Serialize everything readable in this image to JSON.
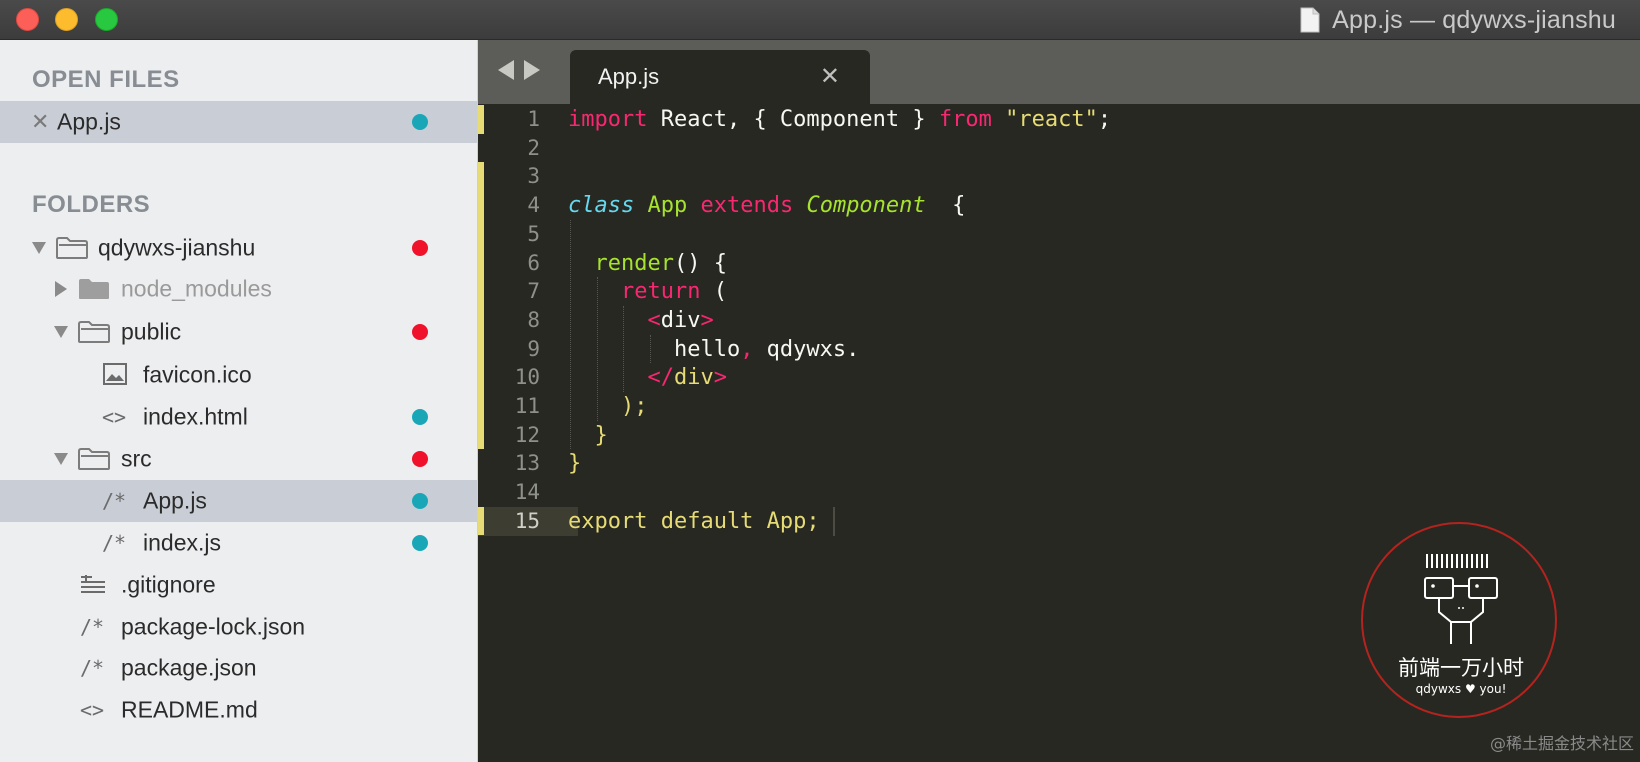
{
  "window": {
    "title": "App.js — qdywxs-jianshu"
  },
  "sidebar": {
    "open_files_header": "OPEN FILES",
    "open_files": [
      {
        "label": "App.js",
        "modified": true
      }
    ],
    "folders_header": "FOLDERS",
    "tree": [
      {
        "label": "qdywxs-jianshu",
        "type": "folder",
        "expanded": true,
        "status": "red"
      },
      {
        "label": "node_modules",
        "type": "folder",
        "expanded": false,
        "dimmed": true
      },
      {
        "label": "public",
        "type": "folder",
        "expanded": true,
        "status": "red"
      },
      {
        "label": "favicon.ico",
        "type": "image"
      },
      {
        "label": "index.html",
        "type": "markup",
        "status": "teal"
      },
      {
        "label": "src",
        "type": "folder",
        "expanded": true,
        "status": "red"
      },
      {
        "label": "App.js",
        "type": "script",
        "status": "teal",
        "selected": true
      },
      {
        "label": "index.js",
        "type": "script",
        "status": "teal"
      },
      {
        "label": ".gitignore",
        "type": "text"
      },
      {
        "label": "package-lock.json",
        "type": "script"
      },
      {
        "label": "package.json",
        "type": "script"
      },
      {
        "label": "README.md",
        "type": "markup"
      }
    ]
  },
  "editor": {
    "tab_label": "App.js",
    "current_line": 15,
    "lines": [
      {
        "n": "1",
        "tokens": [
          [
            "kw",
            "import"
          ],
          [
            "pl",
            " React, { Component } "
          ],
          [
            "kw",
            "from"
          ],
          [
            "pl",
            " "
          ],
          [
            "str",
            "\"react\""
          ],
          [
            "pl",
            ";"
          ]
        ]
      },
      {
        "n": "2",
        "tokens": []
      },
      {
        "n": "3",
        "tokens": []
      },
      {
        "n": "4",
        "tokens": [
          [
            "cls",
            "class"
          ],
          [
            "pl",
            " "
          ],
          [
            "nm",
            "App"
          ],
          [
            "pl",
            " "
          ],
          [
            "kw",
            "extends"
          ],
          [
            "pl",
            " "
          ],
          [
            "inh",
            "Component"
          ],
          [
            "pl",
            "  {"
          ]
        ]
      },
      {
        "n": "5",
        "tokens": []
      },
      {
        "n": "6",
        "tokens": [
          [
            "pl",
            "  "
          ],
          [
            "nm",
            "render"
          ],
          [
            "pl",
            "() {"
          ]
        ]
      },
      {
        "n": "7",
        "tokens": [
          [
            "pl",
            "    "
          ],
          [
            "kw",
            "return"
          ],
          [
            "pl",
            " ("
          ]
        ]
      },
      {
        "n": "8",
        "tokens": [
          [
            "pl",
            "      "
          ],
          [
            "tag",
            "<"
          ],
          [
            "pl",
            "div"
          ],
          [
            "tag",
            ">"
          ]
        ]
      },
      {
        "n": "9",
        "tokens": [
          [
            "pl",
            "        hello"
          ],
          [
            "kw",
            ","
          ],
          [
            "pl",
            " qdywxs."
          ]
        ]
      },
      {
        "n": "10",
        "tokens": [
          [
            "pl",
            "      "
          ],
          [
            "tag",
            "</"
          ],
          [
            "ylw",
            "div"
          ],
          [
            "tag",
            ">"
          ]
        ]
      },
      {
        "n": "11",
        "tokens": [
          [
            "pl",
            "    "
          ],
          [
            "ylw",
            ");"
          ]
        ]
      },
      {
        "n": "12",
        "tokens": [
          [
            "pl",
            "  "
          ],
          [
            "ylw",
            "}"
          ]
        ]
      },
      {
        "n": "13",
        "tokens": [
          [
            "ylw",
            "}"
          ]
        ]
      },
      {
        "n": "14",
        "tokens": []
      },
      {
        "n": "15",
        "tokens": [
          [
            "ylw",
            "export default App;"
          ]
        ]
      }
    ]
  },
  "watermark": {
    "title": "前端一万小时",
    "subtitle": "qdywxs ♥ you!",
    "footer": "@稀土掘金技术社区"
  },
  "colors": {
    "editor_bg": "#272822",
    "keyword": "#f92672",
    "string": "#e6db74",
    "function": "#a6e22e",
    "storage": "#66d9ef",
    "status_teal": "#19a7b8",
    "status_red": "#f0112a"
  }
}
